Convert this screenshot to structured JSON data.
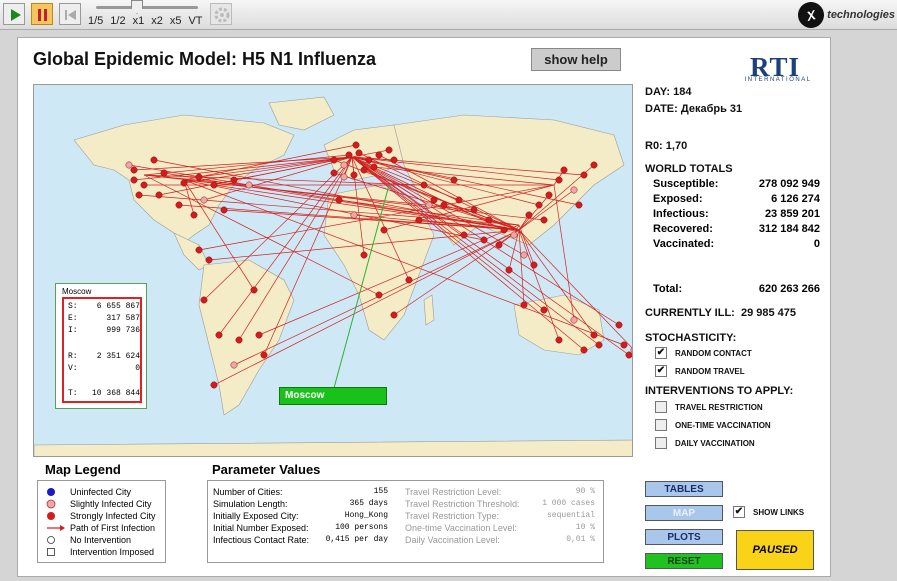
{
  "toolbar": {
    "speeds": [
      "1/5",
      "1/2",
      "x1",
      "x2",
      "x5",
      "VT"
    ],
    "brand_text": "technologies",
    "brand_mark": "X"
  },
  "title": "Global Epidemic Model: H5 N1 Influenza",
  "help_label": "show help",
  "logo": {
    "text": "RTI",
    "sub": "INTERNATIONAL"
  },
  "stats": {
    "day_label": "DAY:",
    "day": "184",
    "date_label": "DATE:",
    "date": "Декабрь 31",
    "r0_label": "R0:",
    "r0": "1,70",
    "world_totals_label": "WORLD TOTALS",
    "rows": [
      {
        "label": "Susceptible:",
        "value": "278 092 949"
      },
      {
        "label": "Exposed:",
        "value": "6 126 274"
      },
      {
        "label": "Infectious:",
        "value": "23 859 201"
      },
      {
        "label": "Recovered:",
        "value": "312 184 842"
      },
      {
        "label": "Vaccinated:",
        "value": "0"
      }
    ],
    "total_label": "Total:",
    "total": "620 263 266",
    "ill_label": "CURRENTLY ILL:",
    "ill": "29 985 475"
  },
  "stochasticity": {
    "label": "STOCHASTICITY:",
    "items": [
      {
        "label": "RANDOM CONTACT",
        "checked": true
      },
      {
        "label": "RANDOM TRAVEL",
        "checked": true
      }
    ]
  },
  "interventions": {
    "label": "INTERVENTIONS TO APPLY:",
    "items": [
      {
        "label": "TRAVEL RESTRICTION",
        "checked": false
      },
      {
        "label": "ONE-TIME VACCINATION",
        "checked": false
      },
      {
        "label": "DAILY VACCINATION",
        "checked": false
      }
    ]
  },
  "info_box": {
    "city": "Moscow",
    "rows": [
      {
        "k": "S:",
        "v": "6 655 867"
      },
      {
        "k": "E:",
        "v": "317 587"
      },
      {
        "k": "I:",
        "v": "999 736"
      },
      {
        "k": "R:",
        "v": "2 351 624"
      },
      {
        "k": "V:",
        "v": "0"
      },
      {
        "k": "T:",
        "v": "10 368 844"
      }
    ]
  },
  "map_label": "Moscow",
  "legend": {
    "title": "Map Legend",
    "items": [
      {
        "label": "Uninfected City",
        "icon": "blue-dot"
      },
      {
        "label": "Slightly Infected City",
        "icon": "pink-dot"
      },
      {
        "label": "Strongly Infected City",
        "icon": "red-dot"
      },
      {
        "label": "Path of First Infection",
        "icon": "red-arrow"
      },
      {
        "label": "No Intervention",
        "icon": "empty-circle"
      },
      {
        "label": "Intervention Imposed",
        "icon": "empty-square"
      }
    ]
  },
  "params": {
    "title": "Parameter Values",
    "left": [
      {
        "label": "Number of Cities:",
        "value": "155"
      },
      {
        "label": "Simulation Length:",
        "value": "365 days"
      },
      {
        "label": "Initially Exposed City:",
        "value": "Hong_Kong"
      },
      {
        "label": "Initial Number Exposed:",
        "value": "100 persons"
      },
      {
        "label": "Infectious Contact Rate:",
        "value": "0,415 per day"
      }
    ],
    "right": [
      {
        "label": "Travel Restriction Level:",
        "value": "90 %"
      },
      {
        "label": "Travel Restriction Threshold:",
        "value": "1 000 cases"
      },
      {
        "label": "Travel Restriction Type:",
        "value": "sequential"
      },
      {
        "label": "One-time Vaccination Level:",
        "value": "10 %"
      },
      {
        "label": "Daily Vaccination Level:",
        "value": "0,01 %"
      }
    ]
  },
  "buttons": {
    "tables": "TABLES",
    "map": "MAP",
    "plots": "PLOTS",
    "reset": "RESET",
    "show_links": "SHOW LINKS",
    "paused": "PAUSED"
  },
  "colors": {
    "ocean": "#cfe8f5",
    "land": "#f3ecc6",
    "link": "#d42020",
    "reset": "#1fc21f",
    "button": "#a9c7ea",
    "paused": "#f9d318"
  }
}
